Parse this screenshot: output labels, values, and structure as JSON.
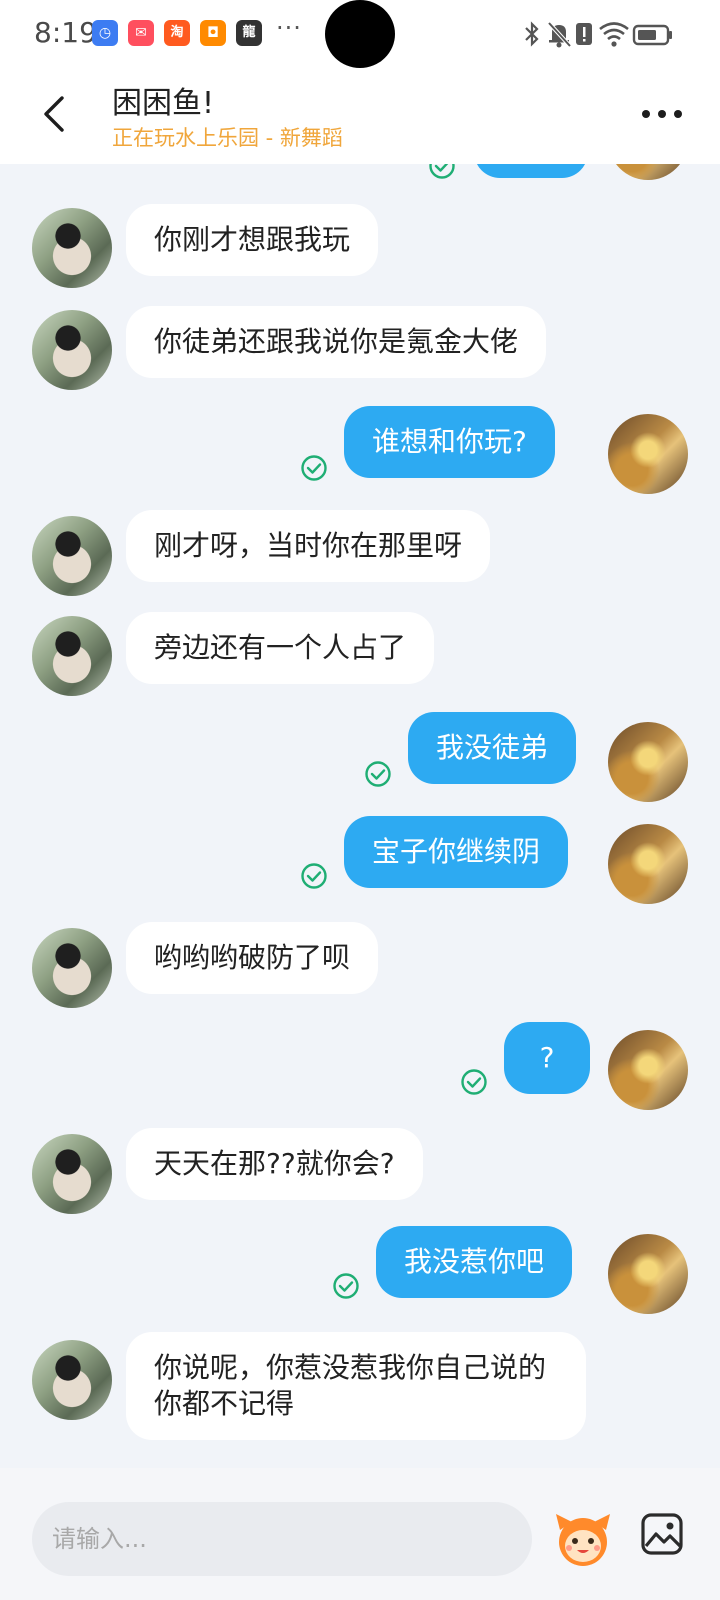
{
  "status_bar": {
    "time": "8:19",
    "more_dots": "···",
    "app_icons": [
      {
        "name": "clock-app-icon",
        "color": "#3d7cf2",
        "glyph": "◷"
      },
      {
        "name": "mail-app-icon",
        "color": "#ff4f5e",
        "glyph": "✉"
      },
      {
        "name": "taobao-app-icon",
        "color": "#ff5a1f",
        "glyph": "淘"
      },
      {
        "name": "shop-app-icon",
        "color": "#ff8a00",
        "glyph": "◘"
      },
      {
        "name": "game-app-icon",
        "color": "#333333",
        "glyph": "龍"
      }
    ]
  },
  "header": {
    "title": "困困鱼!",
    "subtitle": "正在玩水上乐园 - 新舞蹈"
  },
  "messages": [
    {
      "side": "right",
      "text": "",
      "partial": true
    },
    {
      "side": "left",
      "text": "你刚才想跟我玩"
    },
    {
      "side": "left",
      "text": "你徒弟还跟我说你是氪金大佬"
    },
    {
      "side": "right",
      "text": "谁想和你玩?"
    },
    {
      "side": "left",
      "text": "刚才呀，当时你在那里呀"
    },
    {
      "side": "left",
      "text": "旁边还有一个人占了"
    },
    {
      "side": "right",
      "text": "我没徒弟"
    },
    {
      "side": "right",
      "text": "宝子你继续阴"
    },
    {
      "side": "left",
      "text": "哟哟哟破防了呗"
    },
    {
      "side": "right",
      "text": "?"
    },
    {
      "side": "left",
      "text": "天天在那??就你会?"
    },
    {
      "side": "right",
      "text": "我没惹你吧"
    },
    {
      "side": "left",
      "text": "你说呢，你惹没惹我你自己说的你都不记得"
    }
  ],
  "input": {
    "placeholder": "请输入..."
  },
  "colors": {
    "accent": "#2daaf2",
    "subtitle": "#f0a63b",
    "read_check": "#1fae74",
    "background": "#f1f4f9"
  }
}
